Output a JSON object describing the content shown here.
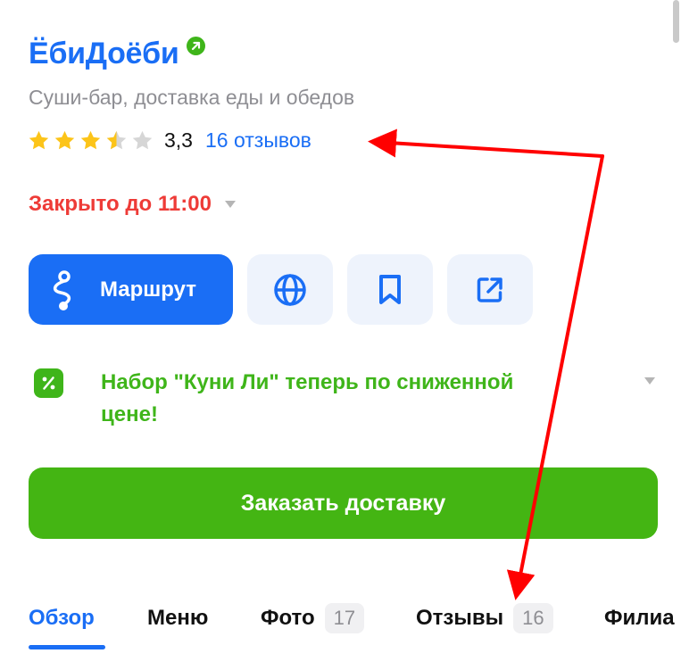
{
  "place": {
    "name": "ЁбиДоёби",
    "category": "Суши-бар, доставка еды и обедов",
    "rating": "3,3",
    "rating_stars": 3.3,
    "reviews_link": "16 отзывов",
    "hours_status": "Закрыто до 11:00"
  },
  "actions": {
    "route_label": "Маршрут",
    "icons": [
      "globe-icon",
      "bookmark-icon",
      "share-icon"
    ]
  },
  "promo": {
    "icon": "percent-icon",
    "text": "Набор \"Куни Ли\" теперь по сниженной цене!"
  },
  "order_button": "Заказать доставку",
  "tabs": [
    {
      "label": "Обзор",
      "count": null,
      "active": true
    },
    {
      "label": "Меню",
      "count": null,
      "active": false
    },
    {
      "label": "Фото",
      "count": "17",
      "active": false
    },
    {
      "label": "Отзывы",
      "count": "16",
      "active": false
    },
    {
      "label": "Филиа",
      "count": null,
      "active": false
    }
  ],
  "colors": {
    "accent": "#1a6ef5",
    "green": "#44b513",
    "closed": "#ee3b37",
    "star": "#fcc419",
    "annotation_arrow": "#ff0000"
  }
}
